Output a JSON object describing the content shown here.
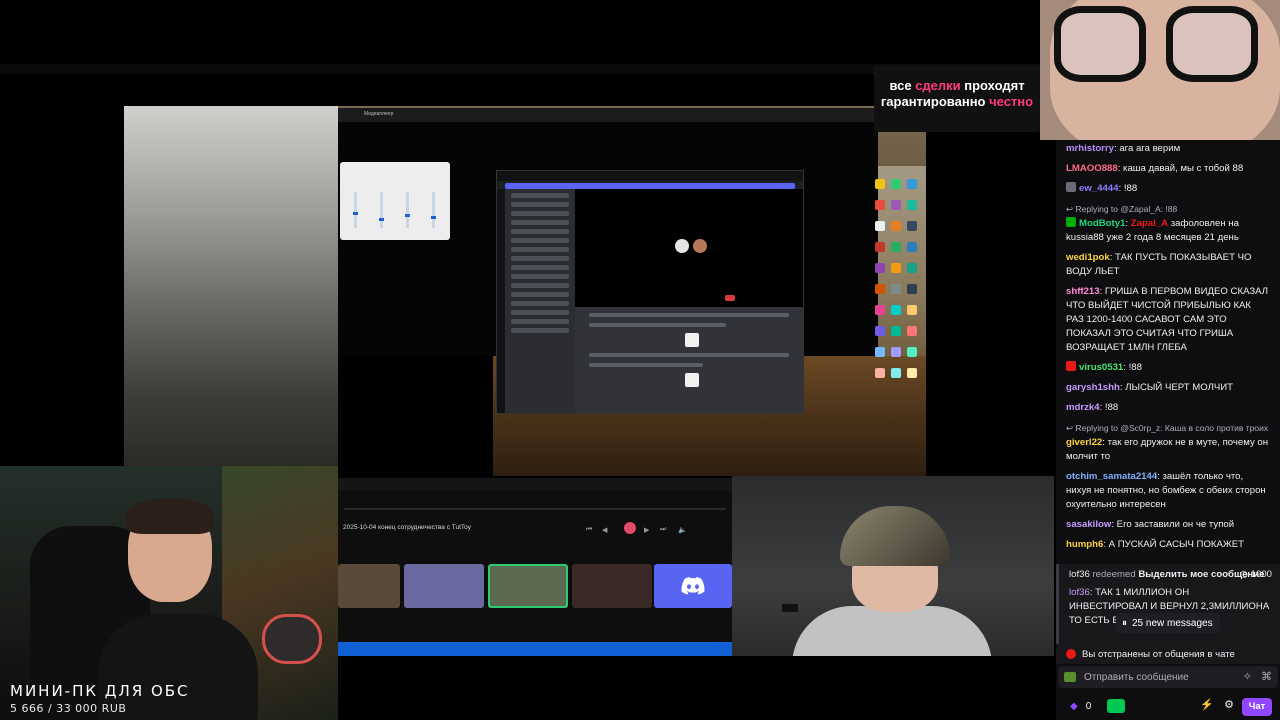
{
  "banner": {
    "line1_white": "все ",
    "line1_accent": "сделки",
    "line1_rest": " проходят",
    "line2_white": "гарантированно ",
    "line2_accent": "честно"
  },
  "window": {
    "title": "Медиаплеер"
  },
  "player": {
    "track_title": "2025-10-04 конец сотрудничества с TutToy"
  },
  "caption": {
    "title": "МИНИ-ПК ДЛЯ ОБС",
    "subtitle": "5 666 / 33 000 RUB"
  },
  "chat": {
    "messages": [
      {
        "user": "mrhistorry",
        "color": "#b98cff",
        "text": ": ага ага верим"
      },
      {
        "user": "LMAOO888",
        "color": "#ff6b8a",
        "text": ": каша давай, мы с тобой 88"
      },
      {
        "user": "ew_4444",
        "color": "#8a7cff",
        "text": ": !88",
        "badge": "block-icon"
      },
      {
        "reply": "Replying to @Zapal_A: !88",
        "user": "ModBoty1",
        "color": "#1fd67a",
        "mention": "Zapal_A",
        "text": " зафоловлен на kussia88 уже 2 года 8 месяцев 21 день",
        "badge": "mod-icon"
      },
      {
        "user": "wedi1pok",
        "color": "#ffd23f",
        "text": ": ТАК ПУСТЬ ПОКАЗЫВАЕТ ЧО ВОДУ ЛЬЕТ"
      },
      {
        "user": "shff213",
        "color": "#ff8ad8",
        "text": ": ГРИША В ПЕРВОМ ВИДЕО СКАЗАЛ ЧТО ВЫЙДЕТ ЧИСТОЙ ПРИБЫЛЬЮ КАК РАЗ 1200-1400 САСАВОТ САМ ЭТО ПОКАЗАЛ ЭТО СЧИТАЯ ЧТО ГРИША ВОЗРАЩАЕТ 1МЛН ГЛЕБА"
      },
      {
        "user": "virus0531",
        "color": "#4be36c",
        "text": ": !88",
        "badge": "vip-icon"
      },
      {
        "user": "garysh1shh",
        "color": "#c79bff",
        "text": ": ЛЫСЫЙ ЧЕРТ МОЛЧИТ"
      },
      {
        "user": "mdrzk4",
        "color": "#c79bff",
        "text": ": !88"
      },
      {
        "reply": "Replying to @Sc0rp_z: Каша в соло против троих",
        "user": "giverl22",
        "color": "#ffd23f",
        "text": ": так его дружок не в муте, почему он молчит то"
      },
      {
        "user": "otchim_samata2144",
        "color": "#7fb0ff",
        "text": ": зашёл только что, нихуя не понятно, но бомбеж с обеих сторон охуительно интересен"
      },
      {
        "user": "sasakilow",
        "color": "#c79bff",
        "text": ": Его заставили он че тупой"
      },
      {
        "user": "humph6",
        "color": "#ffd23f",
        "text": ": А ПУСКАЙ САСЫЧ ПОКАЖЕТ"
      }
    ],
    "redeem": {
      "user": "lof36",
      "verb": "redeemed",
      "reward": "Выделить мое сообщение",
      "cost": "1000"
    },
    "highlighted": {
      "user": "lof36",
      "text": ": ТАК 1 МИЛЛИОН ОН ИНВЕСТИРОВАЛ И ВЕРНУЛ 2,3МИЛЛИОНА ТО ЕСТЬ ВЫГОДА"
    },
    "new_messages": "25 new messages",
    "banned": "Вы отстранены от общения в чате",
    "input_placeholder": "Отправить сообщение",
    "points": "0",
    "send_label": "Чат"
  }
}
